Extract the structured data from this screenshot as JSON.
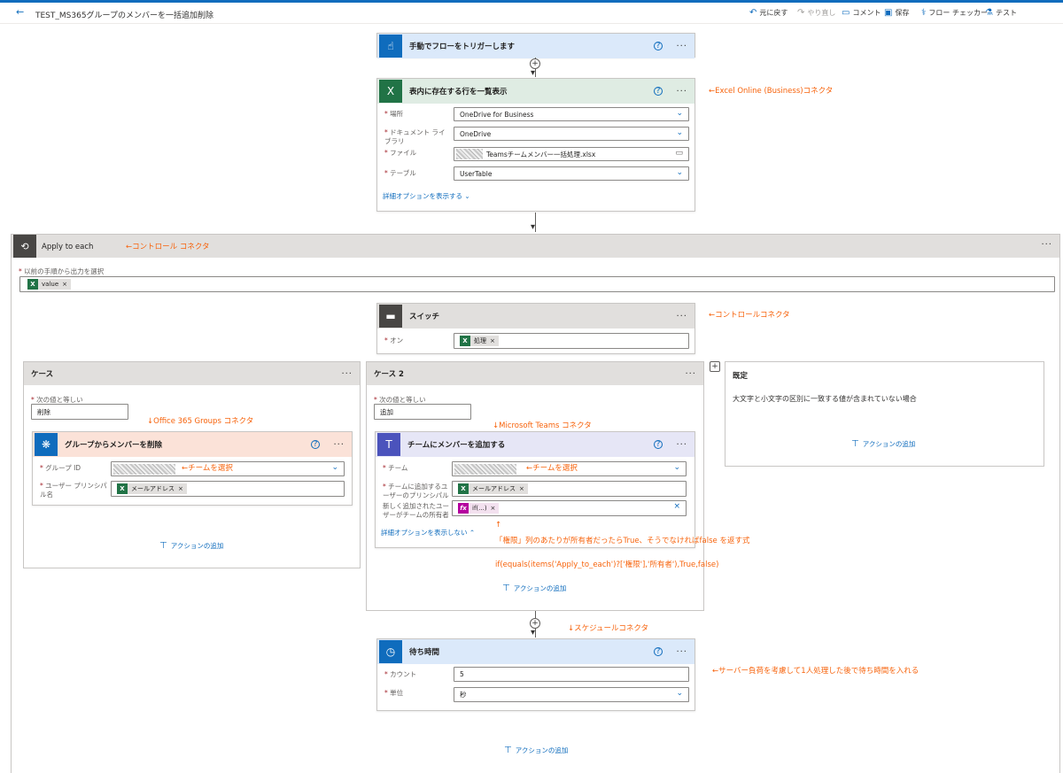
{
  "topbar": {
    "back_icon": "back-arrow-icon",
    "title": "TEST_MS365グループのメンバーを一括追加削除",
    "undo_label": "元に戻す",
    "redo_label": "やり直し",
    "comment_label": "コメント",
    "save_label": "保存",
    "checker_label": "フロー チェッカー",
    "test_label": "テスト"
  },
  "trigger": {
    "title": "手動でフローをトリガーします",
    "color": "#0f6cbd",
    "icon": "touch-icon"
  },
  "excel_step": {
    "title": "表内に存在する行を一覧表示",
    "color": "#217346",
    "icon": "excel-icon",
    "fields": [
      {
        "label": "場所",
        "value": "OneDrive for Business"
      },
      {
        "label": "ドキュメント ライブラリ",
        "value": "OneDrive"
      },
      {
        "label": "ファイル",
        "value": "Teamsチームメンバー一括処理.xlsx"
      },
      {
        "label": "テーブル",
        "value": "UserTable"
      }
    ],
    "advanced_link": "詳細オプションを表示する"
  },
  "apply_each": {
    "title": "Apply to each",
    "select_label": "以前の手順から出力を選択",
    "token": "value"
  },
  "switch_step": {
    "title": "スイッチ",
    "on_label": "オン",
    "token": "処理"
  },
  "case1": {
    "title": "ケース",
    "equals_label": "次の値と等しい",
    "value": "削除",
    "action": {
      "title": "グループからメンバーを削除",
      "color": "#d83b01",
      "group_label": "グループ ID",
      "upn_label": "ユーザー プリンシパル名",
      "upn_token": "メールアドレス"
    },
    "add_action": "アクションの追加"
  },
  "case2": {
    "title": "ケース 2",
    "equals_label": "次の値と等しい",
    "value": "追加",
    "action": {
      "title": "チームにメンバーを追加する",
      "color": "#4b53bc",
      "team_label": "チーム",
      "upn_label": "チームに追加するユーザーのプリンシパル名",
      "upn_token": "メールアドレス",
      "owner_label": "新しく追加されたユーザーがチームの所有者",
      "owner_token": "if(...)",
      "hide_link": "詳細オプションを表示しない"
    },
    "add_action": "アクションの追加"
  },
  "default_case": {
    "title": "既定",
    "description": "大文字と小文字の区別に一致する値が含まれていない場合",
    "add_action": "アクションの追加"
  },
  "delay_step": {
    "title": "待ち時間",
    "color": "#0f6cbd",
    "count_label": "カウント",
    "count_value": "5",
    "unit_label": "単位",
    "unit_value": "秒"
  },
  "bottom_add_action": "アクションの追加",
  "notes": {
    "excel": "←Excel Online (Business)コネクタ",
    "control1": "←コントロール コネクタ",
    "control2": "←コントロールコネクタ",
    "o365": "↓Office 365 Groups コネクタ",
    "teams": "↓Microsoft Teams コネクタ",
    "select_team1": "←チームを選択",
    "select_team2": "←チームを選択",
    "up_arrow": "↑",
    "explain": "「権限」列のあたりが所有者だったらTrue、そうでなければfalse を返す式",
    "formula": "if(equals(items('Apply_to_each')?['権限'],'所有者'),True,false)",
    "schedule": "↓スケジュールコネクタ",
    "wait": "←サーバー負荷を考慮して1人処理した後で待ち時間を入れる"
  }
}
